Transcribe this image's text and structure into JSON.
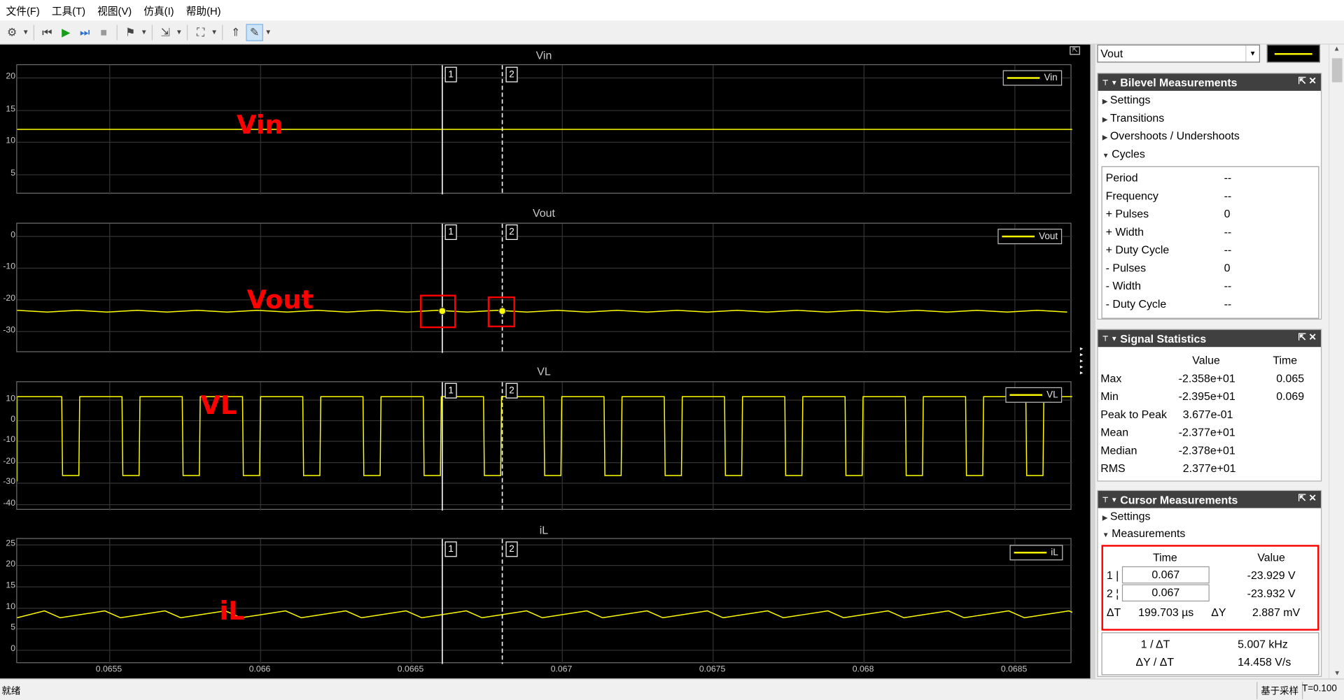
{
  "menu": [
    "文件(F)",
    "工具(T)",
    "视图(V)",
    "仿真(I)",
    "帮助(H)"
  ],
  "toolbar_icons": [
    "gear-icon",
    "step-back-icon",
    "run-icon",
    "step-forward-icon",
    "stop-icon",
    "highlight-signal-icon",
    "zoom-icon",
    "autoscale-icon",
    "trigger-icon",
    "measure-icon"
  ],
  "line_color": "#ffff00",
  "cursor_label_1": "1",
  "cursor_label_2": "2",
  "plots": [
    {
      "title": "Vin",
      "legend": "Vin",
      "annotation": "Vin",
      "yticks": [
        "20",
        "15",
        "10",
        "5"
      ]
    },
    {
      "title": "Vout",
      "legend": "Vout",
      "annotation": "Vout",
      "yticks": [
        "0",
        "-10",
        "-20",
        "-30"
      ]
    },
    {
      "title": "VL",
      "legend": "VL",
      "annotation": "VL",
      "yticks": [
        "10",
        "0",
        "-10",
        "-20",
        "-30",
        "-40"
      ]
    },
    {
      "title": "iL",
      "legend": "iL",
      "annotation": "iL",
      "yticks": [
        "25",
        "20",
        "15",
        "10",
        "5",
        "0"
      ]
    }
  ],
  "xticks": [
    "0.0655",
    "0.066",
    "0.0665",
    "0.067",
    "0.0675",
    "0.068",
    "0.0685"
  ],
  "signal_select": "Vout",
  "bilevel": {
    "title": "Bilevel Measurements",
    "items": [
      "Settings",
      "Transitions",
      "Overshoots / Undershoots",
      "Cycles"
    ],
    "cycles": [
      {
        "label": "Period",
        "value": "--"
      },
      {
        "label": "Frequency",
        "value": "--"
      },
      {
        "label": "+ Pulses",
        "value": "0"
      },
      {
        "label": "+ Width",
        "value": "--"
      },
      {
        "label": "+ Duty Cycle",
        "value": "--"
      },
      {
        "label": "- Pulses",
        "value": "0"
      },
      {
        "label": "- Width",
        "value": "--"
      },
      {
        "label": "- Duty Cycle",
        "value": "--"
      }
    ]
  },
  "stats": {
    "title": "Signal Statistics",
    "col_value": "Value",
    "col_time": "Time",
    "rows": [
      {
        "label": "Max",
        "value": "-2.358e+01",
        "time": "0.065"
      },
      {
        "label": "Min",
        "value": "-2.395e+01",
        "time": "0.069"
      },
      {
        "label": "Peak to Peak",
        "value": "3.677e-01",
        "time": ""
      },
      {
        "label": "Mean",
        "value": "-2.377e+01",
        "time": ""
      },
      {
        "label": "Median",
        "value": "-2.378e+01",
        "time": ""
      },
      {
        "label": "RMS",
        "value": "2.377e+01",
        "time": ""
      }
    ]
  },
  "cursor": {
    "title": "Cursor Measurements",
    "items": [
      "Settings",
      "Measurements"
    ],
    "col_time": "Time",
    "col_value": "Value",
    "c1_label": "1 |",
    "c1_time": "0.067",
    "c1_value": "-23.929 V",
    "c2_label": "2 ¦",
    "c2_time": "0.067",
    "c2_value": "-23.932 V",
    "dt_label": "ΔT",
    "dt_value": "199.703 µs",
    "dy_label": "ΔY",
    "dy_value": "2.887 mV",
    "inv_dt_label": "1 / ΔT",
    "inv_dt_value": "5.007 kHz",
    "slope_label": "ΔY / ΔT",
    "slope_value": "14.458 V/s"
  },
  "status": {
    "left": "就绪",
    "mode": "基于采样",
    "time": "T=0.100"
  }
}
